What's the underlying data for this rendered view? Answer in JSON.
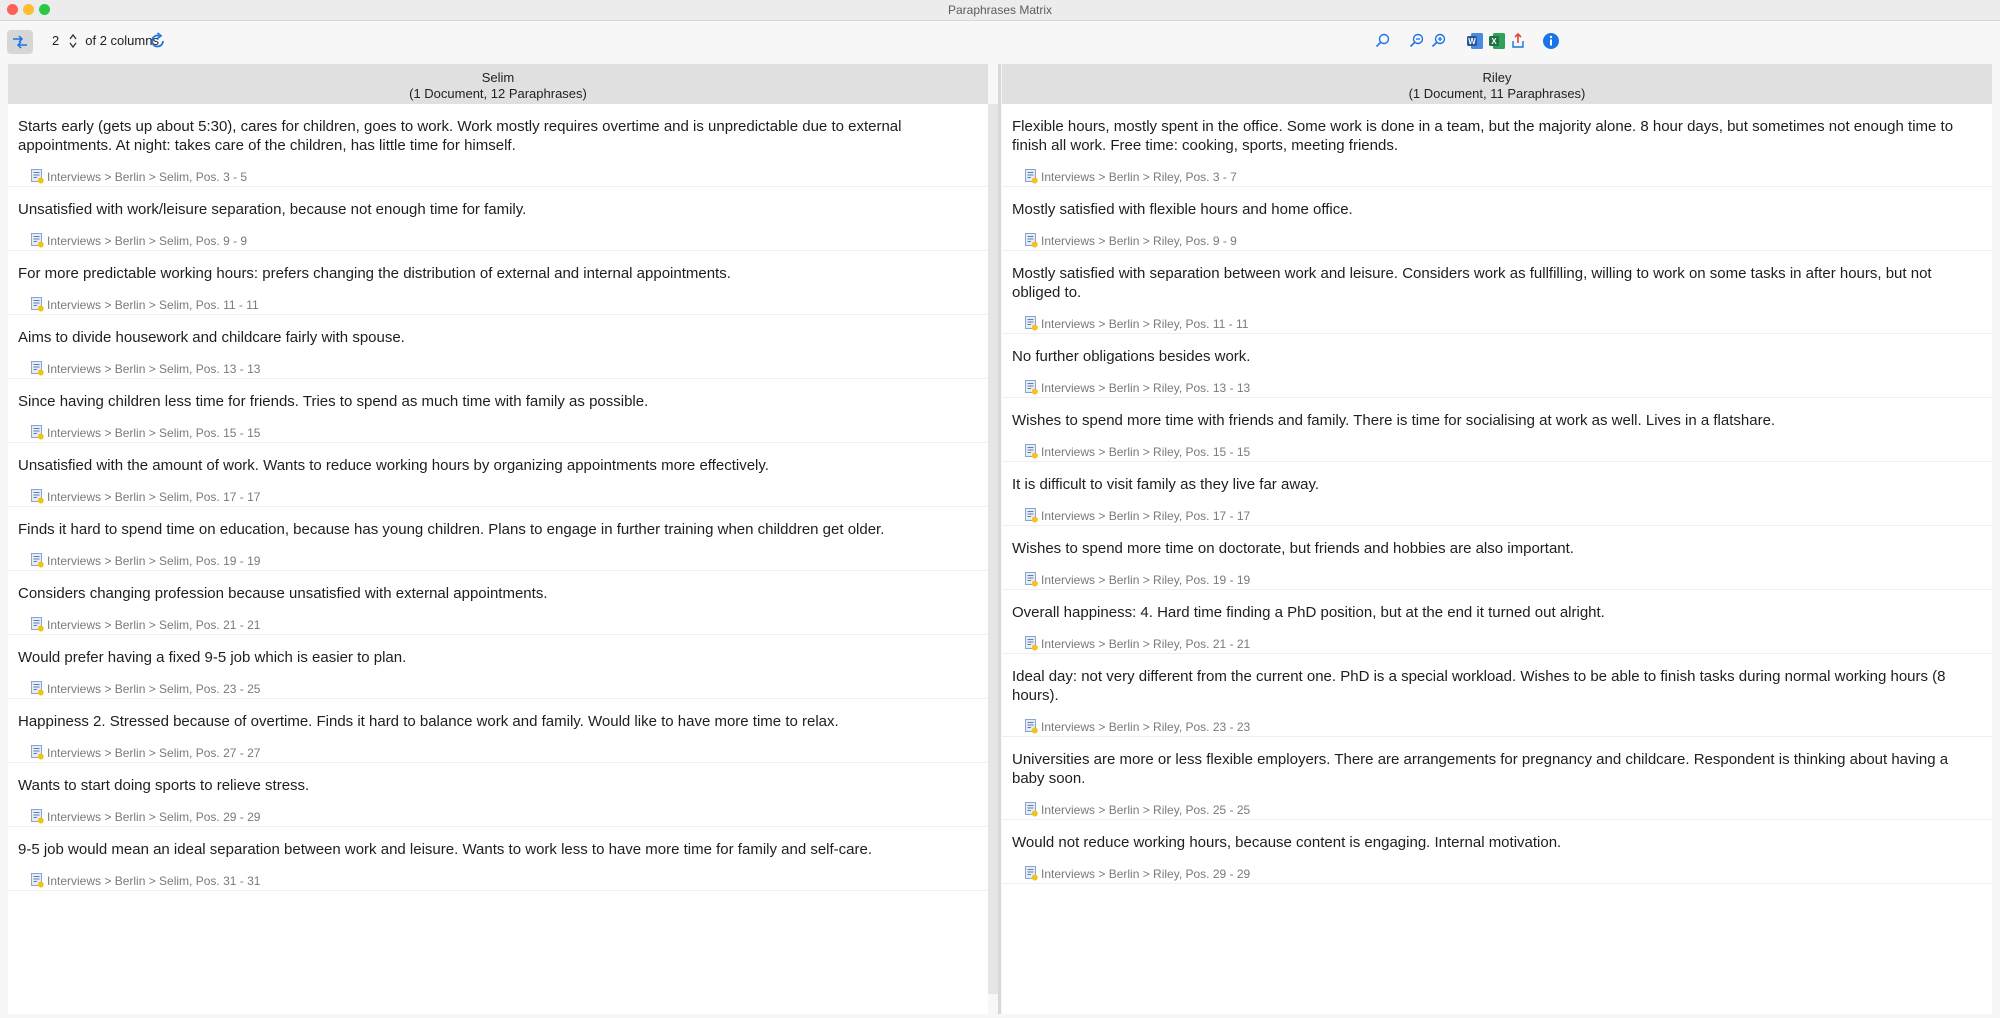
{
  "window": {
    "title": "Paraphrases Matrix"
  },
  "toolbar": {
    "columns_value": "2",
    "columns_suffix": "of 2 columns",
    "icons": [
      "transpose-icon",
      "refresh-icon",
      "search-icon",
      "zoom-out-icon",
      "zoom-in-icon",
      "word-export-icon",
      "excel-export-icon",
      "share-icon",
      "info-icon"
    ]
  },
  "colors": {
    "accent": "#1a73e8",
    "word": "#2b5797",
    "excel": "#1e7145",
    "share": "#e0443a"
  },
  "columns": [
    {
      "name": "Selim",
      "summary": "(1 Document, 12 Paraphrases)",
      "items": [
        {
          "text": "Starts early (gets up about 5:30), cares for children, goes to work. Work mostly requires overtime and is unpredictable due to external appointments. At night: takes care of the children, has little time for himself.",
          "source": "Interviews > Berlin > Selim, Pos. 3 - 5"
        },
        {
          "text": "Unsatisfied with work/leisure separation, because not enough time for family.",
          "source": "Interviews > Berlin > Selim, Pos. 9 - 9"
        },
        {
          "text": "For more predictable working hours: prefers changing the distribution of external and internal appointments.",
          "source": "Interviews > Berlin > Selim, Pos. 11 - 11"
        },
        {
          "text": "Aims to divide housework and childcare fairly with spouse.",
          "source": "Interviews > Berlin > Selim, Pos. 13 - 13"
        },
        {
          "text": "Since having children less time for friends. Tries to spend as much time with family as possible.",
          "source": "Interviews > Berlin > Selim, Pos. 15 - 15"
        },
        {
          "text": "Unsatisfied with the amount of work. Wants to reduce working hours by organizing appointments more effectively.",
          "source": "Interviews > Berlin > Selim, Pos. 17 - 17"
        },
        {
          "text": "Finds it hard to spend time on education, because has young children. Plans to engage in further training when childdren get older.",
          "source": "Interviews > Berlin > Selim, Pos. 19 - 19"
        },
        {
          "text": "Considers changing profession because unsatisfied with external appointments.",
          "source": "Interviews > Berlin > Selim, Pos. 21 - 21"
        },
        {
          "text": "Would prefer having a fixed 9-5 job which is easier to plan.",
          "source": "Interviews > Berlin > Selim, Pos. 23 - 25"
        },
        {
          "text": "Happiness 2. Stressed because of overtime. Finds it hard to balance work and family. Would like to have more time to relax.",
          "source": "Interviews > Berlin > Selim, Pos. 27 - 27"
        },
        {
          "text": "Wants to start doing sports to relieve stress.",
          "source": "Interviews > Berlin > Selim, Pos. 29 - 29"
        },
        {
          "text": "9-5 job would mean an ideal separation between work and leisure. Wants to work less to have more time for family and self-care.",
          "source": "Interviews > Berlin > Selim, Pos. 31 - 31"
        }
      ]
    },
    {
      "name": "Riley",
      "summary": "(1 Document, 11 Paraphrases)",
      "items": [
        {
          "text": "Flexible hours, mostly spent in the office. Some work is done in a team, but the majority alone. 8 hour days, but sometimes not enough time to finish all work. Free time: cooking, sports, meeting friends.",
          "source": "Interviews > Berlin > Riley, Pos. 3 - 7"
        },
        {
          "text": "Mostly satisfied with flexible hours and home office.",
          "source": "Interviews > Berlin > Riley, Pos. 9 - 9"
        },
        {
          "text": "Mostly satisfied with separation between work and leisure. Considers work as fullfilling, willing to work on some tasks in after hours, but not obliged to.",
          "source": "Interviews > Berlin > Riley, Pos. 11 - 11"
        },
        {
          "text": "No further obligations besides work.",
          "source": "Interviews > Berlin > Riley, Pos. 13 - 13"
        },
        {
          "text": "Wishes to spend more time with friends and family. There is time for socialising at work as well. Lives in a flatshare.",
          "source": "Interviews > Berlin > Riley, Pos. 15 - 15"
        },
        {
          "text": "It is difficult to visit family as they live far away.",
          "source": "Interviews > Berlin > Riley, Pos. 17 - 17"
        },
        {
          "text": "Wishes to spend more time on doctorate, but friends and hobbies are also important.",
          "source": "Interviews > Berlin > Riley, Pos. 19 - 19"
        },
        {
          "text": "Overall happiness: 4. Hard time finding a PhD position, but at the end it turned out alright.",
          "source": "Interviews > Berlin > Riley, Pos. 21 - 21"
        },
        {
          "text": "Ideal day: not very different from the current one. PhD is a special workload. Wishes to be able to finish tasks during normal working hours (8 hours).",
          "source": "Interviews > Berlin > Riley, Pos. 23 - 23"
        },
        {
          "text": "Universities are more or less flexible employers. There are arrangements for pregnancy and childcare. Respondent is thinking about having a baby soon.",
          "source": "Interviews > Berlin > Riley, Pos. 25 - 25"
        },
        {
          "text": "Would not reduce working hours, because content is engaging. Internal motivation.",
          "source": "Interviews > Berlin > Riley, Pos. 29 - 29"
        }
      ]
    }
  ]
}
